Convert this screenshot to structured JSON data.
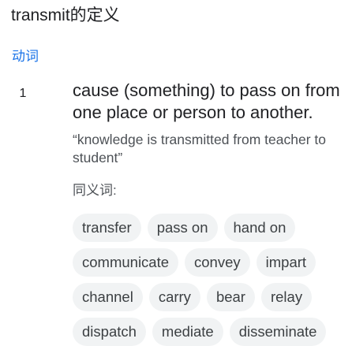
{
  "heading": {
    "title": "transmit的定义"
  },
  "entry": {
    "part_of_speech": "动词",
    "sense_number": "1",
    "definition": "cause (something) to pass on from one place or person to another.",
    "example_line1": "“knowledge is transmitted from teacher to",
    "example_line2": "student”",
    "synonyms_label": "同义词:",
    "synonym_rows": [
      [
        "transfer",
        "pass on",
        "hand on"
      ],
      [
        "communicate",
        "convey",
        "impart"
      ],
      [
        "channel",
        "carry",
        "bear",
        "relay"
      ],
      [
        "dispatch",
        "mediate",
        "disseminate"
      ]
    ]
  }
}
